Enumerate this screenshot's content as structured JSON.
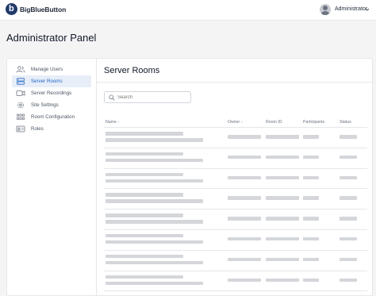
{
  "header": {
    "brand": "BigBlueButton",
    "user_name": "Administrator"
  },
  "page_title": "Administrator Panel",
  "sidebar": {
    "items": [
      {
        "label": "Manage Users",
        "icon": "users-icon",
        "active": false
      },
      {
        "label": "Server Rooms",
        "icon": "server-icon",
        "active": true
      },
      {
        "label": "Server Recordings",
        "icon": "video-icon",
        "active": false
      },
      {
        "label": "Site Settings",
        "icon": "gear-icon",
        "active": false
      },
      {
        "label": "Room Configuration",
        "icon": "room-config-icon",
        "active": false
      },
      {
        "label": "Roles",
        "icon": "roles-icon",
        "active": false
      }
    ]
  },
  "main": {
    "title": "Server Rooms",
    "search_placeholder": "Search",
    "table": {
      "columns": [
        "Name",
        "Owner",
        "Room ID",
        "Participants",
        "Status"
      ],
      "sortable_marker": "↕",
      "loading_rows": 8
    }
  },
  "colors": {
    "accent": "#1e66c7",
    "active_bg": "#e7eef8",
    "skeleton": "#d4d6da",
    "logo": "#1f3a6b"
  }
}
